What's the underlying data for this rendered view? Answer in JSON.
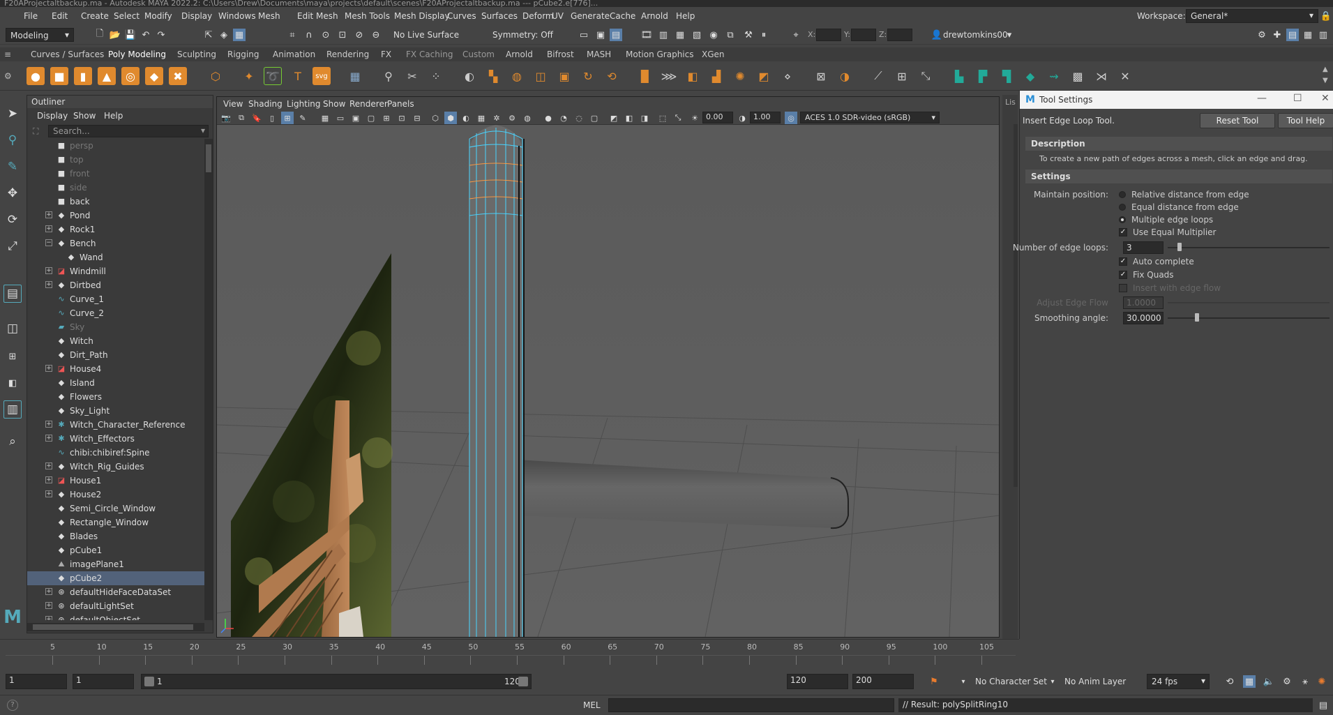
{
  "window": {
    "title": "F20AProjectaltbackup.ma - Autodesk MAYA 2022.2: C:\\Users\\Drew\\Documents\\maya\\projects\\default\\scenes\\F20AProjectaltbackup.ma --- pCube2.e[776]..."
  },
  "menubar": {
    "items": [
      "File",
      "Edit",
      "Create",
      "Select",
      "Modify",
      "Display",
      "Windows",
      "Mesh",
      "Edit Mesh",
      "Mesh Tools",
      "Mesh Display",
      "Curves",
      "Surfaces",
      "Deform",
      "UV",
      "Generate",
      "Cache",
      "Arnold",
      "Help"
    ],
    "workspace_label": "Workspace:",
    "workspace_value": "General*"
  },
  "statusline": {
    "mode": "Modeling",
    "live_surface": "No Live Surface",
    "symmetry": "Symmetry: Off",
    "x_label": "X:",
    "y_label": "Y:",
    "z_label": "Z:",
    "user": "drewtomkins00"
  },
  "shelf": {
    "tabs": [
      "Curves / Surfaces",
      "Poly Modeling",
      "Sculpting",
      "Rigging",
      "Animation",
      "Rendering",
      "FX",
      "FX Caching",
      "Custom",
      "Arnold",
      "Bifrost",
      "MASH",
      "Motion Graphics",
      "XGen"
    ],
    "active_tab": "Poly Modeling"
  },
  "outliner": {
    "title": "Outliner",
    "menu": [
      "Display",
      "Show",
      "Help"
    ],
    "search_placeholder": "Search...",
    "items": [
      {
        "label": "persp",
        "icon": "camera-icon",
        "expand": "",
        "dim": true
      },
      {
        "label": "top",
        "icon": "camera-icon",
        "expand": "",
        "dim": true
      },
      {
        "label": "front",
        "icon": "camera-icon",
        "expand": "",
        "dim": true
      },
      {
        "label": "side",
        "icon": "camera-icon",
        "expand": "",
        "dim": true
      },
      {
        "label": "back",
        "icon": "camera-icon",
        "expand": "",
        "dim": false
      },
      {
        "label": "Pond",
        "icon": "transform-icon",
        "expand": "+",
        "dim": false
      },
      {
        "label": "Rock1",
        "icon": "transform-icon",
        "expand": "+",
        "dim": false
      },
      {
        "label": "Bench",
        "icon": "transform-icon",
        "expand": "-",
        "dim": false
      },
      {
        "label": "Wand",
        "icon": "transform-icon",
        "expand": "",
        "dim": false,
        "indent": true
      },
      {
        "label": "Windmill",
        "icon": "mesh-icon",
        "expand": "+",
        "dim": false
      },
      {
        "label": "Dirtbed",
        "icon": "transform-icon",
        "expand": "+",
        "dim": false
      },
      {
        "label": "Curve_1",
        "icon": "curve-icon",
        "expand": "",
        "dim": false
      },
      {
        "label": "Curve_2",
        "icon": "curve-icon",
        "expand": "",
        "dim": false
      },
      {
        "label": "Sky",
        "icon": "plane-icon",
        "expand": "",
        "dim": true
      },
      {
        "label": "Witch",
        "icon": "transform-icon",
        "expand": "",
        "dim": false
      },
      {
        "label": "Dirt_Path",
        "icon": "transform-icon",
        "expand": "",
        "dim": false
      },
      {
        "label": "House4",
        "icon": "mesh-icon",
        "expand": "+",
        "dim": false
      },
      {
        "label": "Island",
        "icon": "transform-icon",
        "expand": "",
        "dim": false
      },
      {
        "label": "Flowers",
        "icon": "transform-icon",
        "expand": "",
        "dim": false
      },
      {
        "label": "Sky_Light",
        "icon": "light-icon",
        "expand": "",
        "dim": false
      },
      {
        "label": "Witch_Character_Reference",
        "icon": "joint-icon",
        "expand": "+",
        "dim": false
      },
      {
        "label": "Witch_Effectors",
        "icon": "joint-icon",
        "expand": "+",
        "dim": false
      },
      {
        "label": "chibi:chibiref:Spine",
        "icon": "curve-icon",
        "expand": "",
        "dim": false
      },
      {
        "label": "Witch_Rig_Guides",
        "icon": "transform-icon",
        "expand": "+",
        "dim": false
      },
      {
        "label": "House1",
        "icon": "mesh-icon",
        "expand": "+",
        "dim": false
      },
      {
        "label": "House2",
        "icon": "transform-icon",
        "expand": "+",
        "dim": false
      },
      {
        "label": "Semi_Circle_Window",
        "icon": "transform-icon",
        "expand": "",
        "dim": false
      },
      {
        "label": "Rectangle_Window",
        "icon": "transform-icon",
        "expand": "",
        "dim": false
      },
      {
        "label": "Blades",
        "icon": "transform-icon",
        "expand": "",
        "dim": false
      },
      {
        "label": "pCube1",
        "icon": "transform-icon",
        "expand": "",
        "dim": false
      },
      {
        "label": "imagePlane1",
        "icon": "image-plane-icon",
        "expand": "",
        "dim": false
      },
      {
        "label": "pCube2",
        "icon": "transform-icon",
        "expand": "",
        "dim": false,
        "selected": true
      },
      {
        "label": "defaultHideFaceDataSet",
        "icon": "set-icon",
        "expand": "+",
        "dim": false
      },
      {
        "label": "defaultLightSet",
        "icon": "set-icon",
        "expand": "+",
        "dim": false
      },
      {
        "label": "defaultObjectSet",
        "icon": "set-icon",
        "expand": "+",
        "dim": false
      }
    ]
  },
  "viewport": {
    "menu": [
      "View",
      "Shading",
      "Lighting",
      "Show",
      "Renderer",
      "Panels"
    ],
    "exposure": "0.00",
    "gamma": "1.00",
    "colorspace": "ACES 1.0 SDR-video (sRGB)"
  },
  "toolsettings": {
    "title": "Tool Settings",
    "tool_name": "Insert Edge Loop Tool.",
    "reset_button": "Reset Tool",
    "help_button": "Tool Help",
    "description_header": "Description",
    "description": "To create a new path of edges across a mesh, click an edge and drag.",
    "settings_header": "Settings",
    "maintain_position_label": "Maintain position:",
    "options": [
      "Relative distance from edge",
      "Equal distance from edge",
      "Multiple edge loops"
    ],
    "selected_option": 2,
    "use_equal_multiplier": "Use Equal Multiplier",
    "num_loops_label": "Number of edge loops:",
    "num_loops": "3",
    "num_loops_fraction": 0.06,
    "auto_complete": "Auto complete",
    "fix_quads": "Fix Quads",
    "insert_with_edge_flow": "Insert with edge flow",
    "adjust_edge_flow_label": "Adjust Edge Flow",
    "adjust_edge_flow": "1.0000",
    "smoothing_label": "Smoothing angle:",
    "smoothing": "30.0000",
    "smoothing_fraction": 0.17
  },
  "timeline": {
    "ticks": [
      "5",
      "10",
      "15",
      "20",
      "25",
      "30",
      "35",
      "40",
      "45",
      "50",
      "55",
      "60",
      "65",
      "70",
      "75",
      "80",
      "85",
      "90",
      "95",
      "100",
      "105"
    ]
  },
  "range": {
    "start": "1",
    "current": "1",
    "range_start": "1",
    "range_end": "120",
    "anim_end": "120",
    "max_end": "200",
    "character_set": "No Character Set",
    "anim_layer": "No Anim Layer",
    "fps": "24 fps"
  },
  "cmdline": {
    "lang": "MEL",
    "result": "// Result: polySplitRing10"
  }
}
